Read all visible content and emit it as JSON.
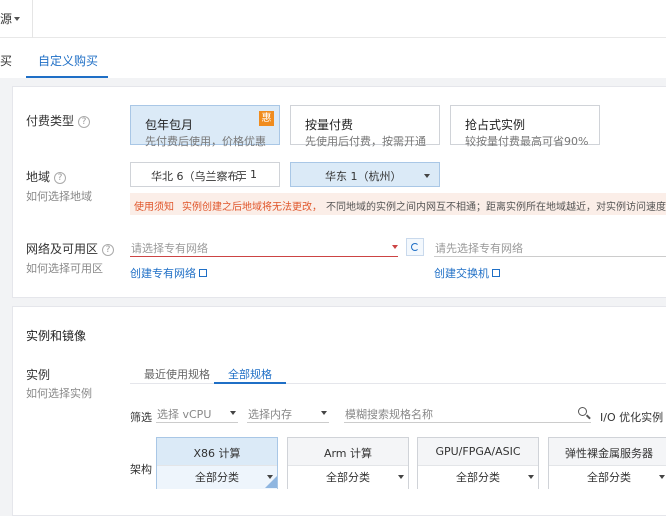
{
  "topbar": {
    "region_label": "源"
  },
  "tabs": {
    "prev_tab_label": "买",
    "active_tab_label": "自定义购买"
  },
  "billing": {
    "label": "付费类型",
    "options": [
      {
        "title": "包年包月",
        "desc": "先付费后使用，价格优惠",
        "badge": "惠"
      },
      {
        "title": "按量付费",
        "desc": "先使用后付费，按需开通"
      },
      {
        "title": "抢占式实例",
        "desc": "较按量付费最高可省90%"
      }
    ]
  },
  "region": {
    "label": "地域",
    "sub": "如何选择地域",
    "option1": "华北 6（乌兰察布）",
    "option2": "华东 1（杭州）",
    "notice_tag": "使用须知",
    "notice_red": "实例创建之后地域将无法更改，",
    "notice_gray": "不同地域的实例之间内网互不相通；距离实例所在地域越近，对实例访问速度越快"
  },
  "network": {
    "label": "网络及可用区",
    "sub": "如何选择可用区",
    "vpc_placeholder": "请选择专有网络",
    "vswitch_placeholder": "请先选择专有网络",
    "create_vpc": "创建专有网络",
    "create_vswitch": "创建交换机"
  },
  "instance_section": {
    "title": "实例和镜像",
    "instance_label": "实例",
    "instance_sub": "如何选择实例",
    "tab_recent": "最近使用规格",
    "tab_all": "全部规格",
    "filter_label": "筛选",
    "vcpu_placeholder": "选择 vCPU",
    "mem_placeholder": "选择内存",
    "search_placeholder": "模糊搜索规格名称",
    "io_label": "I/O 优化实例",
    "arch_label": "架构",
    "archs": [
      {
        "name": "X86 计算",
        "category": "全部分类"
      },
      {
        "name": "Arm 计算",
        "category": "全部分类"
      },
      {
        "name": "GPU/FPGA/ASIC",
        "category": "全部分类"
      },
      {
        "name": "弹性裸金属服务器",
        "category": "全部分类"
      }
    ]
  },
  "colors": {
    "accent": "#1f6fc6",
    "warning": "#e0562b",
    "selected_bg": "#dbeaf7",
    "badge": "#f08c1e"
  }
}
